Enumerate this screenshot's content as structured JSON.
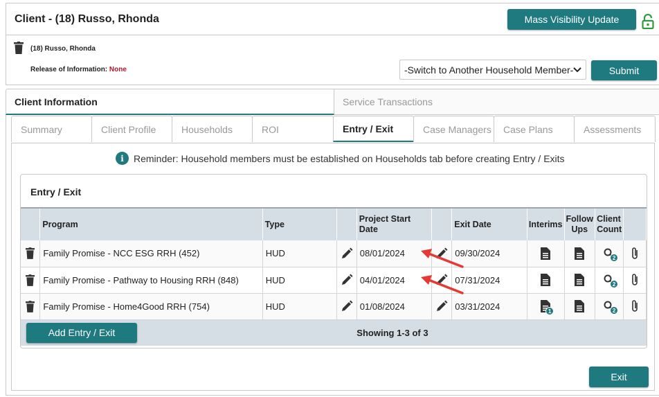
{
  "header": {
    "title": "Client - (18) Russo, Rhonda",
    "mass_visibility_label": "Mass Visibility Update"
  },
  "client": {
    "name": "(18) Russo, Rhonda",
    "roi_label": "Release of Information: ",
    "roi_value": "None",
    "household_select": "-Switch to Another Household Member-",
    "submit_label": "Submit"
  },
  "top_tabs": {
    "client_information": "Client Information",
    "service_transactions": "Service Transactions"
  },
  "sub_tabs": [
    "Summary",
    "Client Profile",
    "Households",
    "ROI",
    "Entry / Exit",
    "Case Managers",
    "Case Plans",
    "Assessments"
  ],
  "reminder": "Reminder: Household members must be established on Households tab before creating Entry / Exits",
  "entry_exit": {
    "title": "Entry / Exit",
    "columns": {
      "program": "Program",
      "type": "Type",
      "start": "Project Start Date",
      "exit": "Exit Date",
      "interims": "Interims",
      "follow_ups": "Follow Ups",
      "client_count": "Client Count"
    },
    "rows": [
      {
        "program": "Family Promise - NCC ESG RRH (452)",
        "type": "HUD",
        "start": "08/01/2024",
        "exit": "09/30/2024",
        "interims_badge": "",
        "client_count": "2"
      },
      {
        "program": "Family Promise - Pathway to Housing RRH (848)",
        "type": "HUD",
        "start": "04/01/2024",
        "exit": "07/31/2024",
        "interims_badge": "",
        "client_count": "2"
      },
      {
        "program": "Family Promise - Home4Good RRH (754)",
        "type": "HUD",
        "start": "01/08/2024",
        "exit": "03/31/2024",
        "interims_badge": "1",
        "client_count": "2"
      }
    ],
    "add_label": "Add Entry / Exit",
    "showing": "Showing 1-3 of 3"
  },
  "exit_label": "Exit",
  "colors": {
    "accent": "#1f7a80",
    "alert": "#b0182b",
    "arrow": "#e53935",
    "header_bg": "#d5dde5"
  }
}
